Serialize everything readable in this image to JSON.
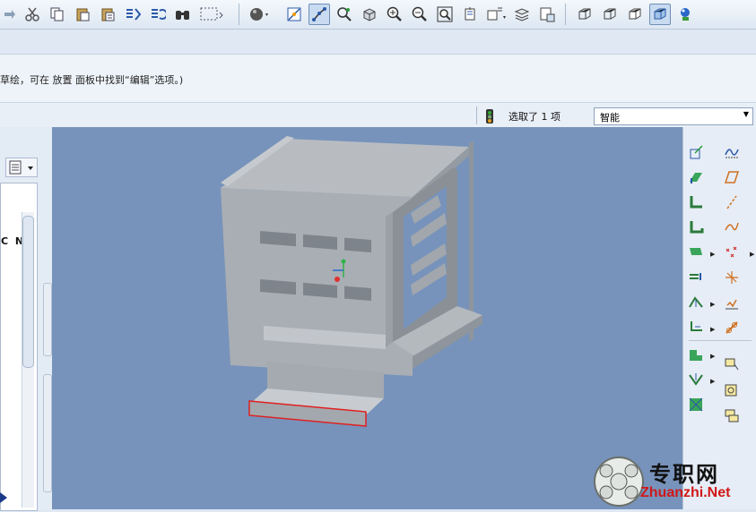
{
  "message": {
    "text": "草绘，可在 放置 面板中找到“编辑”选项。)"
  },
  "selection": {
    "status": "选取了 1 项",
    "filter_value": "智能"
  },
  "left_panel": {
    "label": "C N"
  },
  "watermark": {
    "chinese": "专职网",
    "url": "Zhuanzhi.Net"
  },
  "toolbar_icons": [
    "cut-icon",
    "copy-icon",
    "paste-icon",
    "paste-special-icon",
    "regenerate-icon",
    "regenerate-manager-icon",
    "find-icon",
    "select-box-icon",
    "appearance-icon",
    "refit-icon",
    "datum-display-icon",
    "spin-center-icon",
    "orient-icon",
    "zoom-in-icon",
    "zoom-out-icon",
    "zoom-fit-icon",
    "named-views-icon",
    "layers-icon",
    "annotation-icon",
    "wireframe-icon",
    "hidden-line-icon",
    "no-hidden-icon",
    "shading-icon",
    "model-tree-icon"
  ],
  "colors": {
    "viewport": "#7793bb",
    "model": "#a7adb3",
    "highlight": "#e02020"
  }
}
